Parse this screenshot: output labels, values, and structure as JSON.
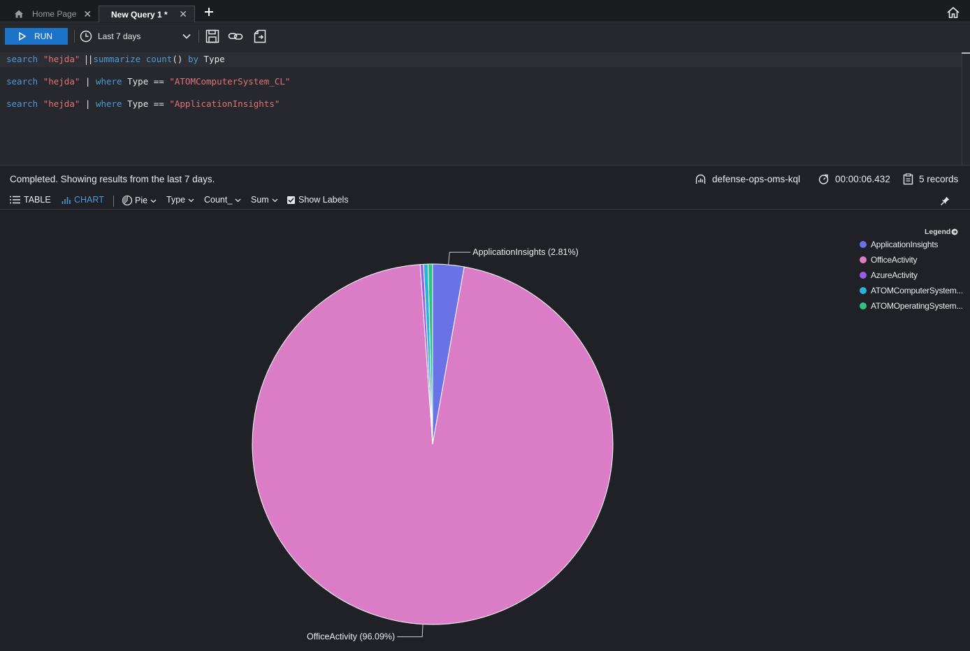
{
  "tabs": [
    {
      "label": "Home Page",
      "close": "✕"
    },
    {
      "label": "New Query 1 *",
      "close": "✕"
    }
  ],
  "toolbar": {
    "run_label": "RUN",
    "time_range": "Last 7 days"
  },
  "editor": {
    "lines": [
      [
        {
          "t": "search",
          "c": "kw"
        },
        {
          "t": " ",
          "c": "op"
        },
        {
          "t": "\"hejda\"",
          "c": "str"
        },
        {
          "t": " ",
          "c": "op"
        },
        {
          "t": "|",
          "c": "op"
        },
        {
          "t": "summarize",
          "c": "kw"
        },
        {
          "t": " ",
          "c": "op"
        },
        {
          "t": "count",
          "c": "fn"
        },
        {
          "t": "()",
          "c": "op"
        },
        {
          "t": " ",
          "c": "op"
        },
        {
          "t": "by",
          "c": "kw"
        },
        {
          "t": " ",
          "c": "op"
        },
        {
          "t": "Type",
          "c": "id"
        }
      ],
      [
        {
          "t": "search",
          "c": "kw"
        },
        {
          "t": " ",
          "c": "op"
        },
        {
          "t": "\"hejda\"",
          "c": "str"
        },
        {
          "t": " | ",
          "c": "op"
        },
        {
          "t": "where",
          "c": "kw"
        },
        {
          "t": " ",
          "c": "op"
        },
        {
          "t": "Type",
          "c": "id"
        },
        {
          "t": " == ",
          "c": "op"
        },
        {
          "t": "\"ATOMComputerSystem_CL\"",
          "c": "str"
        }
      ],
      [
        {
          "t": "search",
          "c": "kw"
        },
        {
          "t": " ",
          "c": "op"
        },
        {
          "t": "\"hejda\"",
          "c": "str"
        },
        {
          "t": " | ",
          "c": "op"
        },
        {
          "t": "where",
          "c": "kw"
        },
        {
          "t": " ",
          "c": "op"
        },
        {
          "t": "Type",
          "c": "id"
        },
        {
          "t": " == ",
          "c": "op"
        },
        {
          "t": "\"ApplicationInsights\"",
          "c": "str"
        }
      ]
    ]
  },
  "status": {
    "message": "Completed. Showing results from the last 7 days.",
    "workspace": "defense-ops-oms-kql",
    "duration": "00:00:06.432",
    "records": "5 records"
  },
  "viewbar": {
    "table_label": "TABLE",
    "chart_label": "CHART",
    "chart_type": "Pie",
    "x_column": "Type",
    "y_column": "Count_",
    "aggregation": "Sum",
    "show_labels": "Show Labels"
  },
  "chart_data": {
    "type": "pie",
    "show_labels": true,
    "legend_title": "Legend",
    "legend_position": "top-right",
    "slices": [
      {
        "name": "ApplicationInsights",
        "legend_label": "ApplicationInsights",
        "percent": 2.81,
        "color": "#6a72e8",
        "label": "ApplicationInsights (2.81%)"
      },
      {
        "name": "OfficeActivity",
        "legend_label": "OfficeActivity",
        "percent": 96.09,
        "color": "#da7dc6",
        "label": "OfficeActivity (96.09%)"
      },
      {
        "name": "AzureActivity",
        "legend_label": "AzureActivity",
        "percent": 0.3,
        "color": "#9a5ee8",
        "label": ""
      },
      {
        "name": "ATOMComputerSystem_CL",
        "legend_label": "ATOMComputerSystem...",
        "percent": 0.4,
        "color": "#29b3d8",
        "label": ""
      },
      {
        "name": "ATOMOperatingSystem_CL",
        "legend_label": "ATOMOperatingSystem...",
        "percent": 0.4,
        "color": "#2ec27e",
        "label": ""
      }
    ]
  },
  "colors": {
    "accent": "#1d73c7",
    "keyword": "#4a9ad8",
    "string": "#e07474"
  }
}
